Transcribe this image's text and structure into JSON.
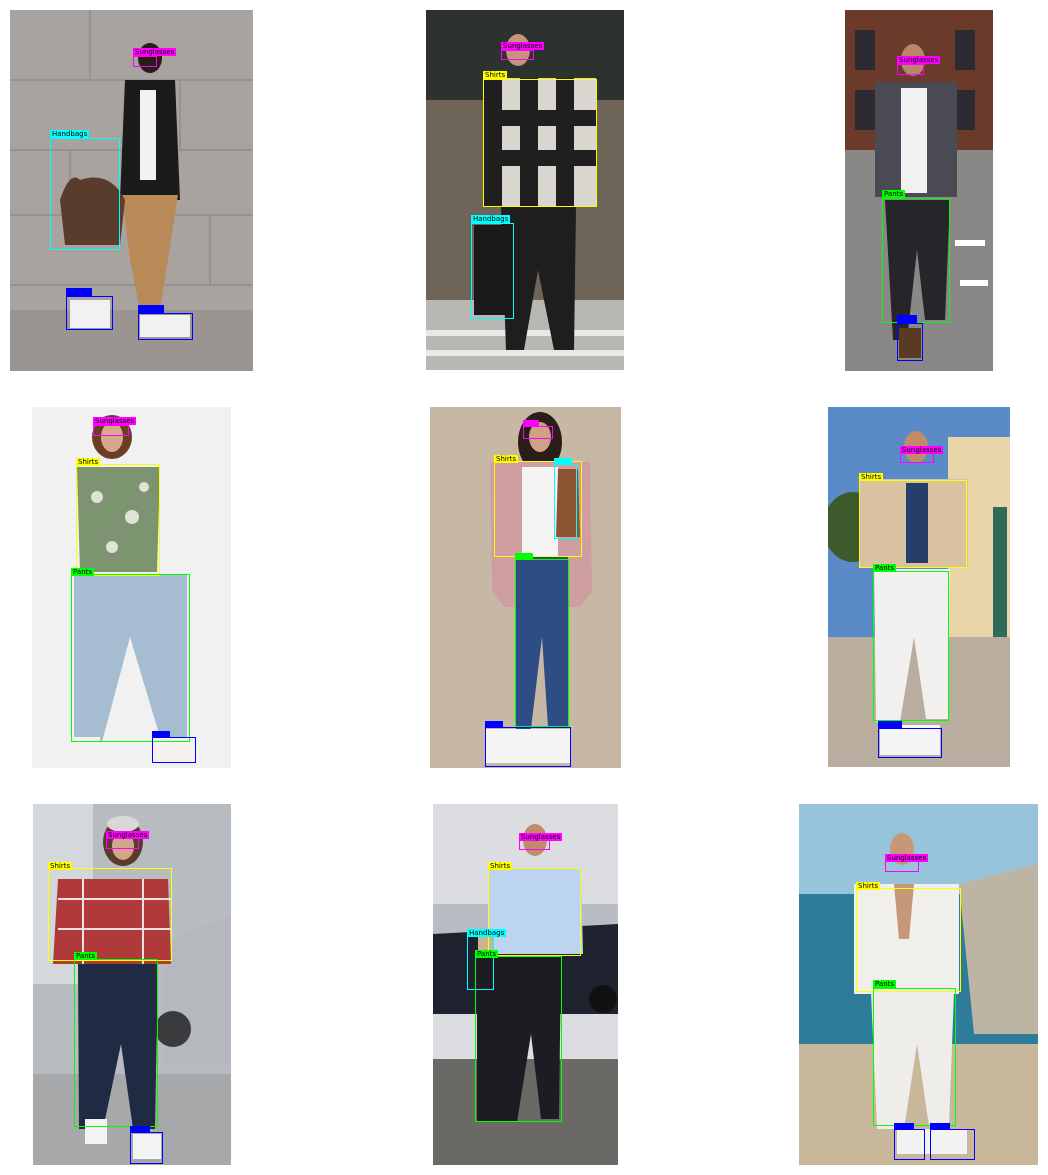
{
  "colors": {
    "Sunglasses": "#ff00ff",
    "Shirts": "#ffff00",
    "Handbags": "#00ffff",
    "Pants": "#00ff00",
    "Shoes": "#0000ff"
  },
  "panels": [
    {
      "id": "p1",
      "boxes": [
        {
          "cls": "Sunglasses",
          "label": "Sunglasses"
        },
        {
          "cls": "Handbags",
          "label": "Handbags"
        },
        {
          "cls": "Shoes",
          "label": ""
        },
        {
          "cls": "Shoes",
          "label": ""
        }
      ]
    },
    {
      "id": "p2",
      "boxes": [
        {
          "cls": "Sunglasses",
          "label": "Sunglasses"
        },
        {
          "cls": "Shirts",
          "label": "Shirts"
        },
        {
          "cls": "Handbags",
          "label": "Handbags"
        }
      ]
    },
    {
      "id": "p3",
      "boxes": [
        {
          "cls": "Sunglasses",
          "label": "Sunglasses"
        },
        {
          "cls": "Pants",
          "label": "Pants"
        },
        {
          "cls": "Shoes",
          "label": ""
        }
      ]
    },
    {
      "id": "p4",
      "boxes": [
        {
          "cls": "Sunglasses",
          "label": "Sunglasses"
        },
        {
          "cls": "Shirts",
          "label": "Shirts"
        },
        {
          "cls": "Pants",
          "label": "Pants"
        },
        {
          "cls": "Shoes",
          "label": ""
        }
      ]
    },
    {
      "id": "p5",
      "boxes": [
        {
          "cls": "Sunglasses",
          "label": ""
        },
        {
          "cls": "Shirts",
          "label": "Shirts"
        },
        {
          "cls": "Handbags",
          "label": ""
        },
        {
          "cls": "Pants",
          "label": ""
        },
        {
          "cls": "Shoes",
          "label": ""
        }
      ]
    },
    {
      "id": "p6",
      "boxes": [
        {
          "cls": "Sunglasses",
          "label": "Sunglasses"
        },
        {
          "cls": "Shirts",
          "label": "Shirts"
        },
        {
          "cls": "Pants",
          "label": "Pants"
        },
        {
          "cls": "Shoes",
          "label": ""
        }
      ]
    },
    {
      "id": "p7",
      "boxes": [
        {
          "cls": "Sunglasses",
          "label": "Sunglasses"
        },
        {
          "cls": "Shirts",
          "label": "Shirts"
        },
        {
          "cls": "Pants",
          "label": "Pants"
        },
        {
          "cls": "Shoes",
          "label": ""
        }
      ]
    },
    {
      "id": "p8",
      "boxes": [
        {
          "cls": "Sunglasses",
          "label": "Sunglasses"
        },
        {
          "cls": "Shirts",
          "label": "Shirts"
        },
        {
          "cls": "Handbags",
          "label": "Handbags"
        },
        {
          "cls": "Pants",
          "label": "Pants"
        }
      ]
    },
    {
      "id": "p9",
      "boxes": [
        {
          "cls": "Sunglasses",
          "label": "Sunglasses"
        },
        {
          "cls": "Shirts",
          "label": "Shirts"
        },
        {
          "cls": "Pants",
          "label": "Pants"
        },
        {
          "cls": "Shoes",
          "label": ""
        },
        {
          "cls": "Shoes",
          "label": ""
        }
      ]
    }
  ]
}
